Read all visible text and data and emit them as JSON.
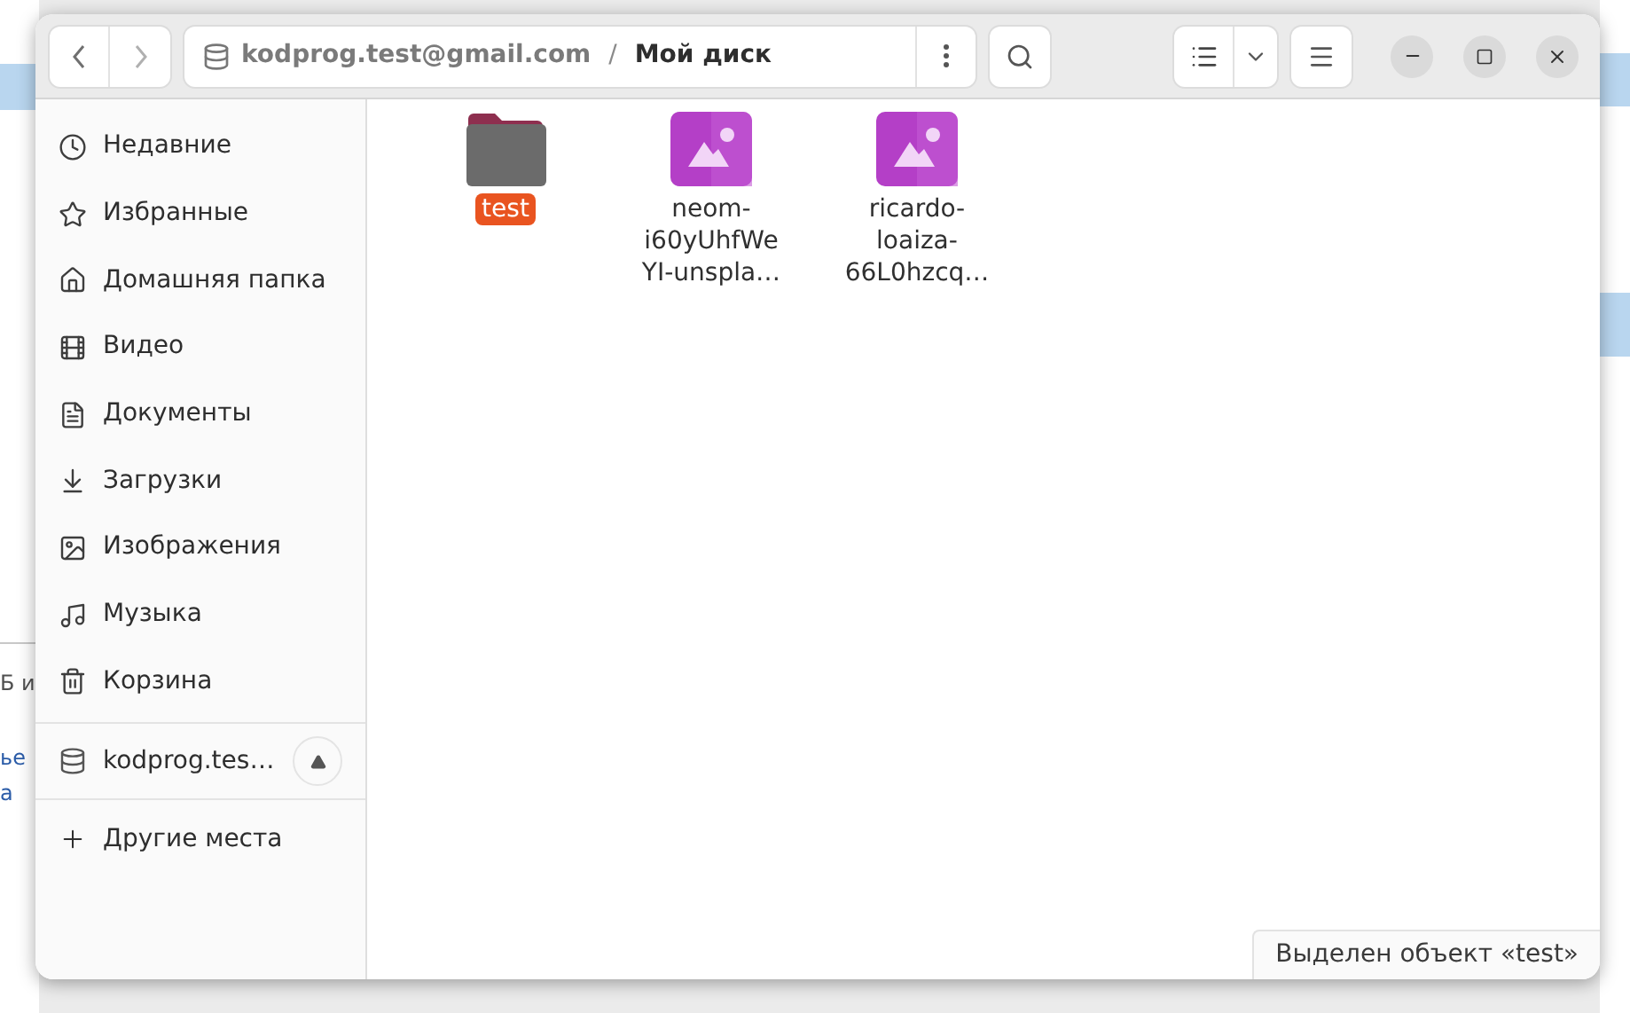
{
  "background": {
    "fragments": [
      {
        "text": "Б и",
        "kind": "plain"
      },
      {
        "text": "ье",
        "kind": "link"
      },
      {
        "text": "а",
        "kind": "link"
      }
    ]
  },
  "window": {
    "separator": "/",
    "path": [
      {
        "text": "kodprog.test@gmail.com",
        "current": false
      },
      {
        "text": "Мой диск",
        "current": true
      }
    ],
    "sidebar": {
      "places": [
        {
          "label": "Недавние"
        },
        {
          "label": "Избранные"
        },
        {
          "label": "Домашняя папка"
        },
        {
          "label": "Видео"
        },
        {
          "label": "Документы"
        },
        {
          "label": "Загрузки"
        },
        {
          "label": "Изображения"
        },
        {
          "label": "Музыка"
        },
        {
          "label": "Корзина"
        }
      ],
      "drives": [
        {
          "label": "kodprog.tes…"
        }
      ],
      "other": "Другие места"
    },
    "files": [
      {
        "name": "test",
        "kind": "folder",
        "selected": true
      },
      {
        "name": "neom-\ni60yUhfWe\nYI-unspla…",
        "kind": "image",
        "selected": false
      },
      {
        "name": "ricardo-\nloaiza-\n66L0hzcq…",
        "kind": "image",
        "selected": false
      }
    ],
    "status_bar": "Выделен объект «test»"
  }
}
